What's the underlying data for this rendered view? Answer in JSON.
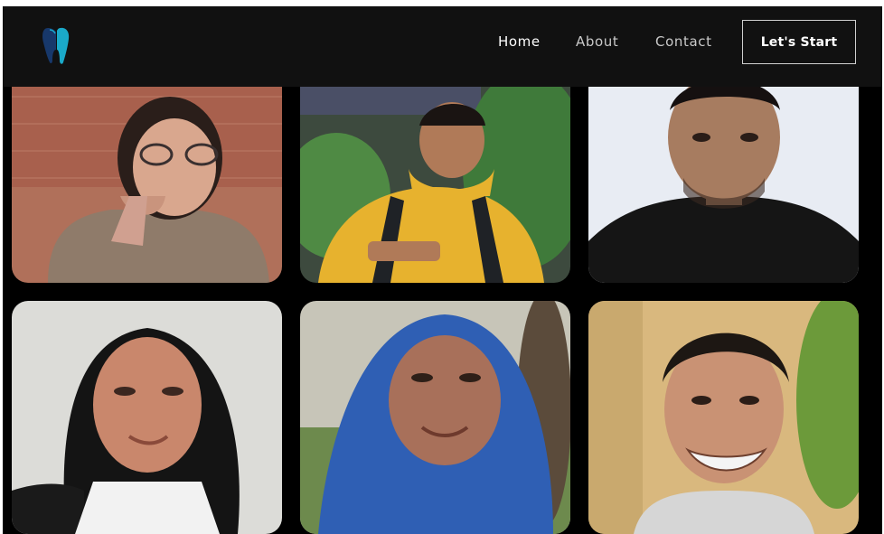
{
  "nav": {
    "logo_icon": "tooth-icon",
    "links": [
      "Home",
      "About",
      "Contact"
    ],
    "active": "Home",
    "cta_label": "Let's Start"
  },
  "colors": {
    "navbar_bg": "#111111",
    "page_bg": "#000000",
    "logo_primary": "#1aa9c9",
    "logo_dark": "#17386b"
  },
  "gallery": {
    "photos": [
      {
        "name": "team-photo-1",
        "subject": "young woman with glasses, hand on chin, brick wall background"
      },
      {
        "name": "team-photo-2",
        "subject": "young man in yellow hoodie holding phone outdoors"
      },
      {
        "name": "team-photo-3",
        "subject": "young man in black t-shirt, white background"
      },
      {
        "name": "team-photo-4",
        "subject": "young woman in black hijab, light background"
      },
      {
        "name": "team-photo-5",
        "subject": "smiling young woman in blue hijab outdoors"
      },
      {
        "name": "team-photo-6",
        "subject": "smiling young man, green plants background"
      }
    ]
  }
}
